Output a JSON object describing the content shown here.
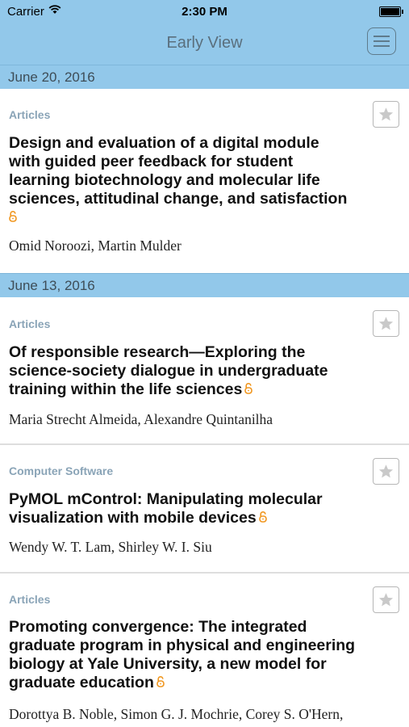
{
  "status_bar": {
    "carrier": "Carrier",
    "time": "2:30 PM"
  },
  "nav": {
    "title": "Early View",
    "menu_icon": "hamburger-menu-icon"
  },
  "sections": [
    {
      "date": "June 20, 2016"
    },
    {
      "date": "June 13, 2016"
    }
  ],
  "articles": [
    {
      "category": "Articles",
      "title_lines": [
        "Design and evaluation of a digital module",
        "with guided peer feedback for student",
        "learning biotechnology and molecular life",
        "sciences, attitudinal change, and satisfaction"
      ],
      "authors": "Omid Noroozi, Martin Mulder",
      "open_access": true
    },
    {
      "category": "Articles",
      "title_lines": [
        "Of responsible research—Exploring the",
        "science-society dialogue in undergraduate",
        "training within the life sciences"
      ],
      "authors": "Maria Strecht Almeida, Alexandre Quintanilha",
      "open_access": true
    },
    {
      "category": "Computer Software",
      "title_lines": [
        "PyMOL mControl: Manipulating molecular",
        "visualization with mobile devices"
      ],
      "authors": "Wendy W. T. Lam, Shirley W. I. Siu",
      "open_access": true
    },
    {
      "category": "Articles",
      "title_lines": [
        "Promoting convergence: The integrated",
        "graduate program in physical and engineering",
        "biology at Yale University, a new model for",
        "graduate education"
      ],
      "authors": "Dorottya B. Noble, Simon G. J. Mochrie, Corey S. O'Hern,",
      "open_access": true
    }
  ],
  "colors": {
    "bar": "#92c8ea",
    "category": "#8aa4b7",
    "lock": "#f0961e",
    "divider": "#dedede"
  }
}
